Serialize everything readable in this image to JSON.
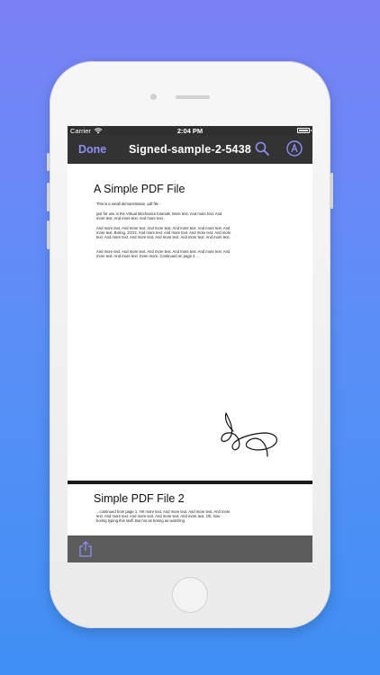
{
  "status_bar": {
    "carrier": "Carrier",
    "time": "2:04 PM"
  },
  "navbar": {
    "done_label": "Done",
    "title": "Signed-sample-2-5438"
  },
  "colors": {
    "accent": "#8b8ff6",
    "navbar_bg": "#333333",
    "toolbar_bg": "#5c5c5c",
    "background_top": "#7b82f6",
    "background_bottom": "#3f8ff4"
  },
  "icons": {
    "wifi": "wifi-icon",
    "battery": "battery-icon",
    "search": "search-icon",
    "markup": "markup-pen-icon",
    "share": "share-icon"
  },
  "document": {
    "page1": {
      "title": "A Simple PDF File",
      "paragraphs": [
        "This is a small demonstration .pdf file -",
        "just for use in the Virtual Mechanics tutorials. More text. And more text. And more text. And more text. And more text.",
        "And more text. And more text. And more text. And more text. And more text. And more text. Boring, zzzzz. And more text. And more text. And more text. And more text. And more text. And more text. And more text. And more text. And more text.",
        "And more text. And more text. And more text. And more text. And more text. And more text. And more text. Even more. Continued on page 2 ..."
      ]
    },
    "page2": {
      "title": "Simple PDF File 2",
      "paragraphs": [
        "...continued from page 1. Yet more text. And more text. And more text. And more text. And more text. And more text. And more text. And more text. Oh, how boring typing this stuff. But not as boring as watching"
      ]
    }
  }
}
